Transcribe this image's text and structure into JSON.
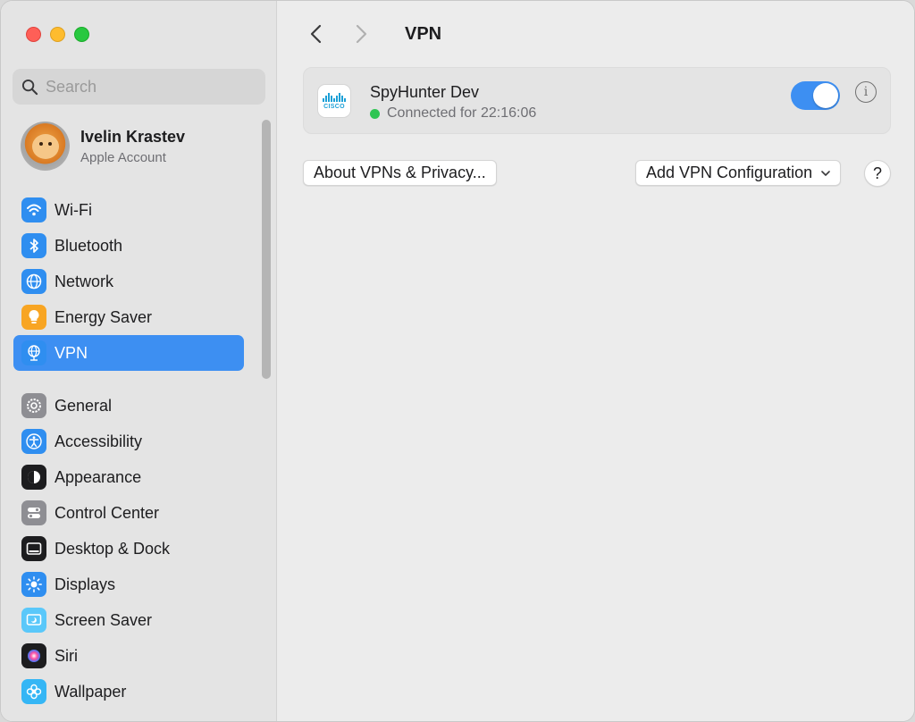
{
  "sidebar": {
    "search": {
      "placeholder": "Search"
    },
    "account": {
      "name": "Ivelin Krastev",
      "subtitle": "Apple Account"
    },
    "group1": [
      {
        "label": "Wi-Fi",
        "icon": "wifi-icon",
        "color": "#2f8ef0"
      },
      {
        "label": "Bluetooth",
        "icon": "bluetooth-icon",
        "color": "#2f8ef0"
      },
      {
        "label": "Network",
        "icon": "globe-icon",
        "color": "#2f8ef0"
      },
      {
        "label": "Energy Saver",
        "icon": "lightbulb-icon",
        "color": "#f8a523"
      },
      {
        "label": "VPN",
        "icon": "vpn-globe-icon",
        "color": "#2f8ef0",
        "active": true
      }
    ],
    "group2": [
      {
        "label": "General",
        "icon": "gear-icon",
        "color": "#8e8e93"
      },
      {
        "label": "Accessibility",
        "icon": "accessibility-icon",
        "color": "#2f8ef0"
      },
      {
        "label": "Appearance",
        "icon": "appearance-icon",
        "color": "#1d1d1f"
      },
      {
        "label": "Control Center",
        "icon": "control-center-icon",
        "color": "#8e8e93"
      },
      {
        "label": "Desktop & Dock",
        "icon": "desktop-dock-icon",
        "color": "#1d1d1f"
      },
      {
        "label": "Displays",
        "icon": "sun-icon",
        "color": "#2f8ef0"
      },
      {
        "label": "Screen Saver",
        "icon": "screen-saver-icon",
        "color": "#5ac8fa"
      },
      {
        "label": "Siri",
        "icon": "siri-icon",
        "color": "#1d1d1f"
      },
      {
        "label": "Wallpaper",
        "icon": "flower-icon",
        "color": "#35b6f5"
      }
    ]
  },
  "main": {
    "title": "VPN",
    "vpn": {
      "name": "SpyHunter Dev",
      "status": "Connected for 22:16:06",
      "logo_text": "CISCO",
      "enabled": true
    },
    "about_button": "About VPNs & Privacy...",
    "add_button": "Add VPN Configuration",
    "help_button": "?"
  },
  "colors": {
    "accent": "#3d8ff2",
    "status_connected": "#2fc553"
  }
}
